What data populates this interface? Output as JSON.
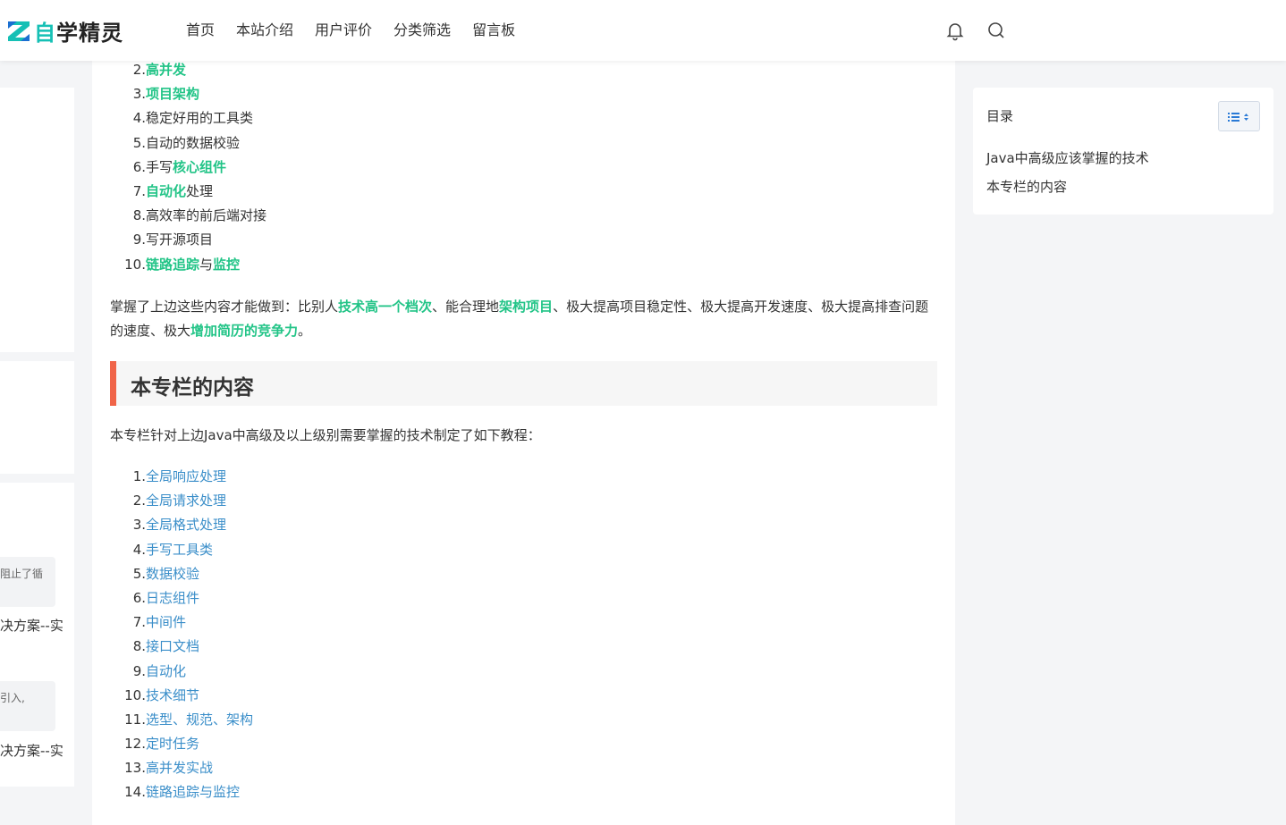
{
  "brand": {
    "name_part1": "自",
    "name_part2": "学精灵"
  },
  "nav": [
    "首页",
    "本站介绍",
    "用户评价",
    "分类筛选",
    "留言板"
  ],
  "header_icons": [
    "bell-icon",
    "search-icon"
  ],
  "left_sidebar": {
    "snippet1": "阻止了循",
    "title1": "决方案--实例",
    "snippet2": "引入,",
    "title2": "决方案--实例"
  },
  "article": {
    "skills_list": [
      {
        "num": "2.",
        "parts": [
          {
            "text": "高并发",
            "style": "hl"
          }
        ]
      },
      {
        "num": "3.",
        "parts": [
          {
            "text": "项目架构",
            "style": "hl"
          }
        ]
      },
      {
        "num": "4.",
        "parts": [
          {
            "text": "稳定好用的工具类",
            "style": "plain"
          }
        ]
      },
      {
        "num": "5.",
        "parts": [
          {
            "text": "自动的数据校验",
            "style": "plain"
          }
        ]
      },
      {
        "num": "6.",
        "parts": [
          {
            "text": "手写",
            "style": "plain"
          },
          {
            "text": "核心组件",
            "style": "hl"
          }
        ]
      },
      {
        "num": "7.",
        "parts": [
          {
            "text": "自动化",
            "style": "hl"
          },
          {
            "text": "处理",
            "style": "plain"
          }
        ]
      },
      {
        "num": "8.",
        "parts": [
          {
            "text": "高效率的前后端对接",
            "style": "plain"
          }
        ]
      },
      {
        "num": "9.",
        "parts": [
          {
            "text": "写开源项目",
            "style": "plain"
          }
        ]
      },
      {
        "num": "10.",
        "parts": [
          {
            "text": "链路追踪",
            "style": "hl"
          },
          {
            "text": "与",
            "style": "plain"
          },
          {
            "text": "监控",
            "style": "hl"
          }
        ]
      }
    ],
    "summary_parts": [
      {
        "text": "掌握了上边这些内容才能做到：比别人",
        "style": "plain"
      },
      {
        "text": "技术高一个档次",
        "style": "hl"
      },
      {
        "text": "、能合理地",
        "style": "plain"
      },
      {
        "text": "架构项目",
        "style": "hl"
      },
      {
        "text": "、极大提高项目稳定性、极大提高开发速度、极大提高排查问题的速度、极大",
        "style": "plain"
      },
      {
        "text": "增加简历的竞争力",
        "style": "hl"
      },
      {
        "text": "。",
        "style": "plain"
      }
    ],
    "section_heading": "本专栏的内容",
    "intro": "本专栏针对上边Java中高级及以上级别需要掌握的技术制定了如下教程：",
    "tutorials": [
      {
        "num": "1.",
        "label": "全局响应处理"
      },
      {
        "num": "2.",
        "label": "全局请求处理"
      },
      {
        "num": "3.",
        "label": "全局格式处理"
      },
      {
        "num": "4.",
        "label": "手写工具类"
      },
      {
        "num": "5.",
        "label": "数据校验"
      },
      {
        "num": "6.",
        "label": "日志组件"
      },
      {
        "num": "7.",
        "label": "中间件"
      },
      {
        "num": "8.",
        "label": "接口文档"
      },
      {
        "num": "9.",
        "label": "自动化"
      },
      {
        "num": "10.",
        "label": "技术细节"
      },
      {
        "num": "11.",
        "label": "选型、规范、架构"
      },
      {
        "num": "12.",
        "label": "定时任务"
      },
      {
        "num": "13.",
        "label": "高并发实战"
      },
      {
        "num": "14.",
        "label": "链路追踪与监控"
      }
    ]
  },
  "toc": {
    "title": "目录",
    "toggle_icon": "list-toggle-icon",
    "items": [
      "Java中高级应该掌握的技术",
      "本专栏的内容"
    ]
  },
  "colors": {
    "accent_green": "#22c487",
    "link_blue": "#3a8ec9",
    "heading_bar": "#f06448",
    "brand_teal": "#16c0b5"
  }
}
